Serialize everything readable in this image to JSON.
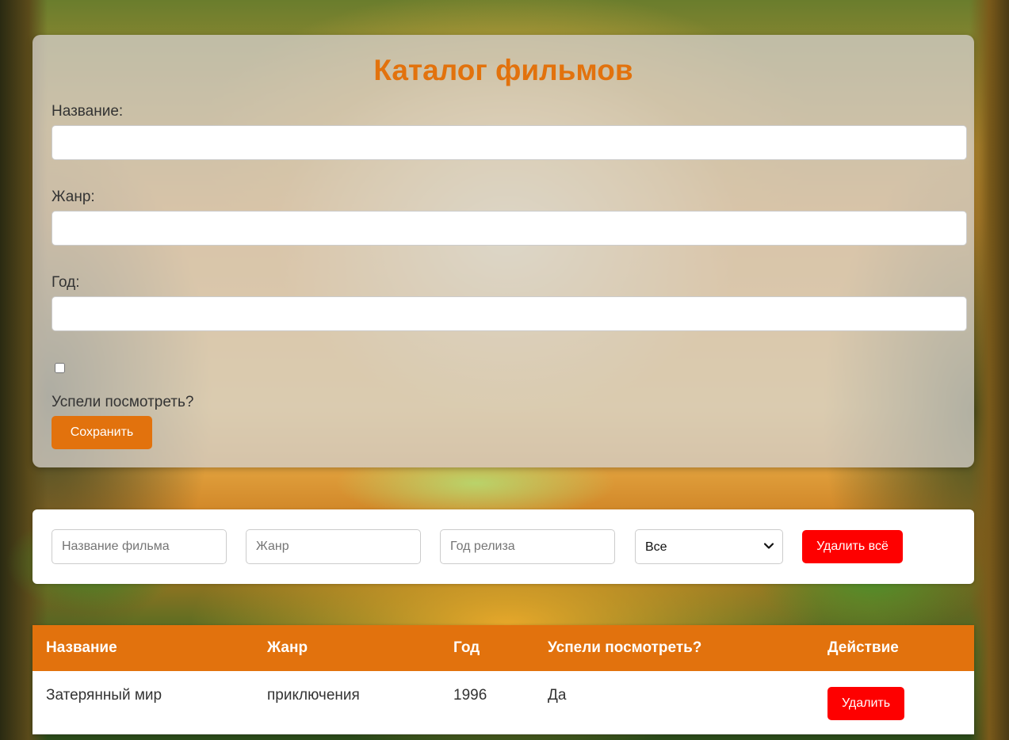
{
  "form": {
    "title": "Каталог фильмов",
    "title_label": "Название:",
    "genre_label": "Жанр:",
    "year_label": "Год:",
    "watched_label": "Успели посмотреть?",
    "title_value": "",
    "genre_value": "",
    "year_value": "",
    "watched_checked": false,
    "save_label": "Сохранить"
  },
  "filters": {
    "title_placeholder": "Название фильма",
    "genre_placeholder": "Жанр",
    "year_placeholder": "Год релиза",
    "watched_selected": "Все",
    "delete_all_label": "Удалить всё"
  },
  "table": {
    "headers": {
      "title": "Название",
      "genre": "Жанр",
      "year": "Год",
      "watched": "Успели посмотреть?",
      "action": "Действие"
    },
    "rows": [
      {
        "title": "Затерянный мир",
        "genre": "приключения",
        "year": "1996",
        "watched": "Да",
        "delete_label": "Удалить"
      }
    ]
  },
  "colors": {
    "accent": "#e2720d",
    "danger": "#fe0000"
  }
}
